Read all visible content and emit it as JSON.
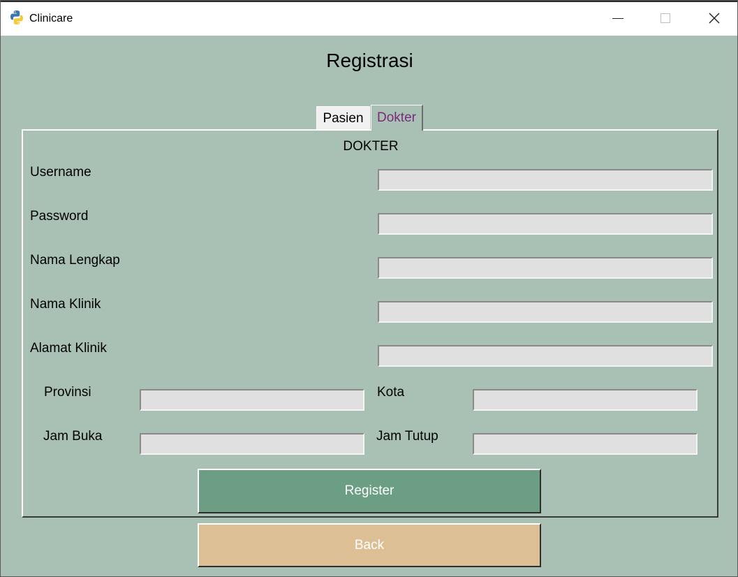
{
  "window": {
    "title": "Clinicare",
    "icon": "python-logo-icon"
  },
  "page": {
    "title": "Registrasi"
  },
  "tabs": [
    {
      "label": "Pasien",
      "selected": false
    },
    {
      "label": "Dokter",
      "selected": true
    }
  ],
  "form": {
    "section_title": "DOKTER",
    "username": {
      "label": "Username",
      "value": ""
    },
    "password": {
      "label": "Password",
      "value": ""
    },
    "nama_lengkap": {
      "label": "Nama Lengkap",
      "value": ""
    },
    "nama_klinik": {
      "label": "Nama Klinik",
      "value": ""
    },
    "alamat_klinik": {
      "label": "Alamat Klinik",
      "value": ""
    },
    "provinsi": {
      "label": "Provinsi",
      "value": ""
    },
    "kota": {
      "label": "Kota",
      "value": ""
    },
    "jam_buka": {
      "label": "Jam Buka",
      "value": ""
    },
    "jam_tutup": {
      "label": "Jam Tutup",
      "value": ""
    }
  },
  "buttons": {
    "register": "Register",
    "back": "Back"
  },
  "colors": {
    "background": "#a8c1b4",
    "register_button": "#6b9e83",
    "back_button": "#ddbf96",
    "selected_tab_text": "#7b2a7d",
    "field_background": "#e0e0e0"
  }
}
